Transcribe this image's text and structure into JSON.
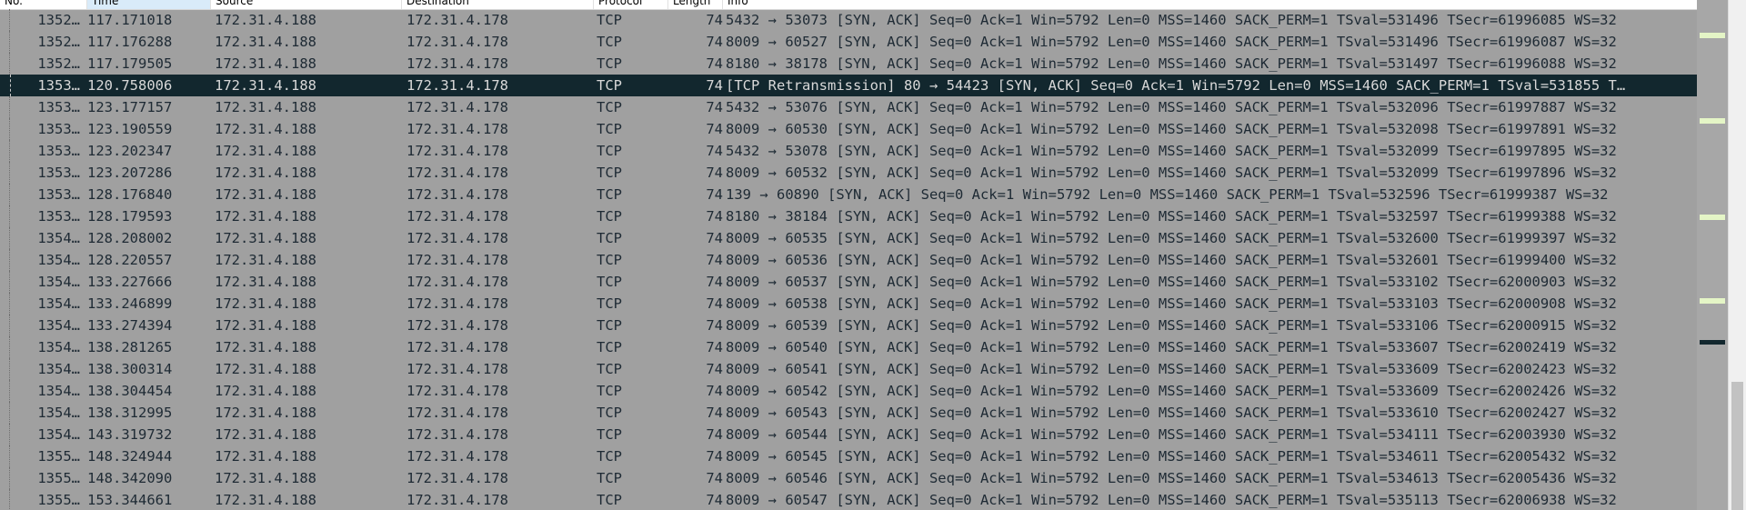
{
  "columns": [
    {
      "key": "no",
      "label": "No."
    },
    {
      "key": "time",
      "label": "Time"
    },
    {
      "key": "source",
      "label": "Source"
    },
    {
      "key": "destination",
      "label": "Destination"
    },
    {
      "key": "protocol",
      "label": "Protocol"
    },
    {
      "key": "length",
      "label": "Length"
    },
    {
      "key": "info",
      "label": "Info"
    }
  ],
  "packets": [
    {
      "no": "1352…",
      "time": "117.171018",
      "source": "172.31.4.188",
      "destination": "172.31.4.178",
      "protocol": "TCP",
      "length": "74",
      "info": "5432 → 53073 [SYN, ACK] Seq=0 Ack=1 Win=5792 Len=0 MSS=1460 SACK_PERM=1 TSval=531496 TSecr=61996085 WS=32"
    },
    {
      "no": "1352…",
      "time": "117.176288",
      "source": "172.31.4.188",
      "destination": "172.31.4.178",
      "protocol": "TCP",
      "length": "74",
      "info": "8009 → 60527 [SYN, ACK] Seq=0 Ack=1 Win=5792 Len=0 MSS=1460 SACK_PERM=1 TSval=531496 TSecr=61996087 WS=32"
    },
    {
      "no": "1352…",
      "time": "117.179505",
      "source": "172.31.4.188",
      "destination": "172.31.4.178",
      "protocol": "TCP",
      "length": "74",
      "info": "8180 → 38178 [SYN, ACK] Seq=0 Ack=1 Win=5792 Len=0 MSS=1460 SACK_PERM=1 TSval=531497 TSecr=61996088 WS=32"
    },
    {
      "no": "1353…",
      "time": "120.758006",
      "source": "172.31.4.188",
      "destination": "172.31.4.178",
      "protocol": "TCP",
      "length": "74",
      "info": "[TCP Retransmission] 80 → 54423 [SYN, ACK] Seq=0 Ack=1 Win=5792 Len=0 MSS=1460 SACK_PERM=1 TSval=531855 T…",
      "selected": true
    },
    {
      "no": "1353…",
      "time": "123.177157",
      "source": "172.31.4.188",
      "destination": "172.31.4.178",
      "protocol": "TCP",
      "length": "74",
      "info": "5432 → 53076 [SYN, ACK] Seq=0 Ack=1 Win=5792 Len=0 MSS=1460 SACK_PERM=1 TSval=532096 TSecr=61997887 WS=32"
    },
    {
      "no": "1353…",
      "time": "123.190559",
      "source": "172.31.4.188",
      "destination": "172.31.4.178",
      "protocol": "TCP",
      "length": "74",
      "info": "8009 → 60530 [SYN, ACK] Seq=0 Ack=1 Win=5792 Len=0 MSS=1460 SACK_PERM=1 TSval=532098 TSecr=61997891 WS=32"
    },
    {
      "no": "1353…",
      "time": "123.202347",
      "source": "172.31.4.188",
      "destination": "172.31.4.178",
      "protocol": "TCP",
      "length": "74",
      "info": "5432 → 53078 [SYN, ACK] Seq=0 Ack=1 Win=5792 Len=0 MSS=1460 SACK_PERM=1 TSval=532099 TSecr=61997895 WS=32"
    },
    {
      "no": "1353…",
      "time": "123.207286",
      "source": "172.31.4.188",
      "destination": "172.31.4.178",
      "protocol": "TCP",
      "length": "74",
      "info": "8009 → 60532 [SYN, ACK] Seq=0 Ack=1 Win=5792 Len=0 MSS=1460 SACK_PERM=1 TSval=532099 TSecr=61997896 WS=32"
    },
    {
      "no": "1353…",
      "time": "128.176840",
      "source": "172.31.4.188",
      "destination": "172.31.4.178",
      "protocol": "TCP",
      "length": "74",
      "info": "139 → 60890 [SYN, ACK] Seq=0 Ack=1 Win=5792 Len=0 MSS=1460 SACK_PERM=1 TSval=532596 TSecr=61999387 WS=32"
    },
    {
      "no": "1353…",
      "time": "128.179593",
      "source": "172.31.4.188",
      "destination": "172.31.4.178",
      "protocol": "TCP",
      "length": "74",
      "info": "8180 → 38184 [SYN, ACK] Seq=0 Ack=1 Win=5792 Len=0 MSS=1460 SACK_PERM=1 TSval=532597 TSecr=61999388 WS=32"
    },
    {
      "no": "1354…",
      "time": "128.208002",
      "source": "172.31.4.188",
      "destination": "172.31.4.178",
      "protocol": "TCP",
      "length": "74",
      "info": "8009 → 60535 [SYN, ACK] Seq=0 Ack=1 Win=5792 Len=0 MSS=1460 SACK_PERM=1 TSval=532600 TSecr=61999397 WS=32"
    },
    {
      "no": "1354…",
      "time": "128.220557",
      "source": "172.31.4.188",
      "destination": "172.31.4.178",
      "protocol": "TCP",
      "length": "74",
      "info": "8009 → 60536 [SYN, ACK] Seq=0 Ack=1 Win=5792 Len=0 MSS=1460 SACK_PERM=1 TSval=532601 TSecr=61999400 WS=32"
    },
    {
      "no": "1354…",
      "time": "133.227666",
      "source": "172.31.4.188",
      "destination": "172.31.4.178",
      "protocol": "TCP",
      "length": "74",
      "info": "8009 → 60537 [SYN, ACK] Seq=0 Ack=1 Win=5792 Len=0 MSS=1460 SACK_PERM=1 TSval=533102 TSecr=62000903 WS=32"
    },
    {
      "no": "1354…",
      "time": "133.246899",
      "source": "172.31.4.188",
      "destination": "172.31.4.178",
      "protocol": "TCP",
      "length": "74",
      "info": "8009 → 60538 [SYN, ACK] Seq=0 Ack=1 Win=5792 Len=0 MSS=1460 SACK_PERM=1 TSval=533103 TSecr=62000908 WS=32"
    },
    {
      "no": "1354…",
      "time": "133.274394",
      "source": "172.31.4.188",
      "destination": "172.31.4.178",
      "protocol": "TCP",
      "length": "74",
      "info": "8009 → 60539 [SYN, ACK] Seq=0 Ack=1 Win=5792 Len=0 MSS=1460 SACK_PERM=1 TSval=533106 TSecr=62000915 WS=32"
    },
    {
      "no": "1354…",
      "time": "138.281265",
      "source": "172.31.4.188",
      "destination": "172.31.4.178",
      "protocol": "TCP",
      "length": "74",
      "info": "8009 → 60540 [SYN, ACK] Seq=0 Ack=1 Win=5792 Len=0 MSS=1460 SACK_PERM=1 TSval=533607 TSecr=62002419 WS=32"
    },
    {
      "no": "1354…",
      "time": "138.300314",
      "source": "172.31.4.188",
      "destination": "172.31.4.178",
      "protocol": "TCP",
      "length": "74",
      "info": "8009 → 60541 [SYN, ACK] Seq=0 Ack=1 Win=5792 Len=0 MSS=1460 SACK_PERM=1 TSval=533609 TSecr=62002423 WS=32"
    },
    {
      "no": "1354…",
      "time": "138.304454",
      "source": "172.31.4.188",
      "destination": "172.31.4.178",
      "protocol": "TCP",
      "length": "74",
      "info": "8009 → 60542 [SYN, ACK] Seq=0 Ack=1 Win=5792 Len=0 MSS=1460 SACK_PERM=1 TSval=533609 TSecr=62002426 WS=32"
    },
    {
      "no": "1354…",
      "time": "138.312995",
      "source": "172.31.4.188",
      "destination": "172.31.4.178",
      "protocol": "TCP",
      "length": "74",
      "info": "8009 → 60543 [SYN, ACK] Seq=0 Ack=1 Win=5792 Len=0 MSS=1460 SACK_PERM=1 TSval=533610 TSecr=62002427 WS=32"
    },
    {
      "no": "1354…",
      "time": "143.319732",
      "source": "172.31.4.188",
      "destination": "172.31.4.178",
      "protocol": "TCP",
      "length": "74",
      "info": "8009 → 60544 [SYN, ACK] Seq=0 Ack=1 Win=5792 Len=0 MSS=1460 SACK_PERM=1 TSval=534111 TSecr=62003930 WS=32"
    },
    {
      "no": "1355…",
      "time": "148.324944",
      "source": "172.31.4.188",
      "destination": "172.31.4.178",
      "protocol": "TCP",
      "length": "74",
      "info": "8009 → 60545 [SYN, ACK] Seq=0 Ack=1 Win=5792 Len=0 MSS=1460 SACK_PERM=1 TSval=534611 TSecr=62005432 WS=32"
    },
    {
      "no": "1355…",
      "time": "148.342090",
      "source": "172.31.4.188",
      "destination": "172.31.4.178",
      "protocol": "TCP",
      "length": "74",
      "info": "8009 → 60546 [SYN, ACK] Seq=0 Ack=1 Win=5792 Len=0 MSS=1460 SACK_PERM=1 TSval=534613 TSecr=62005436 WS=32"
    },
    {
      "no": "1355…",
      "time": "153.344661",
      "source": "172.31.4.188",
      "destination": "172.31.4.178",
      "protocol": "TCP",
      "length": "74",
      "info": "8009 → 60547 [SYN, ACK] Seq=0 Ack=1 Win=5792 Len=0 MSS=1460 SACK_PERM=1 TSval=535113 TSecr=62006938 WS=32"
    }
  ],
  "colors": {
    "row_bg": "#a0a0a0",
    "row_text": "#1e2a34",
    "selected_bg": "#12272e",
    "selected_text": "#d8d8d8",
    "minimap_highlight": "#e4f5c6",
    "minimap_selected": "#12272e",
    "sorted_header": "#d9ebf9"
  }
}
